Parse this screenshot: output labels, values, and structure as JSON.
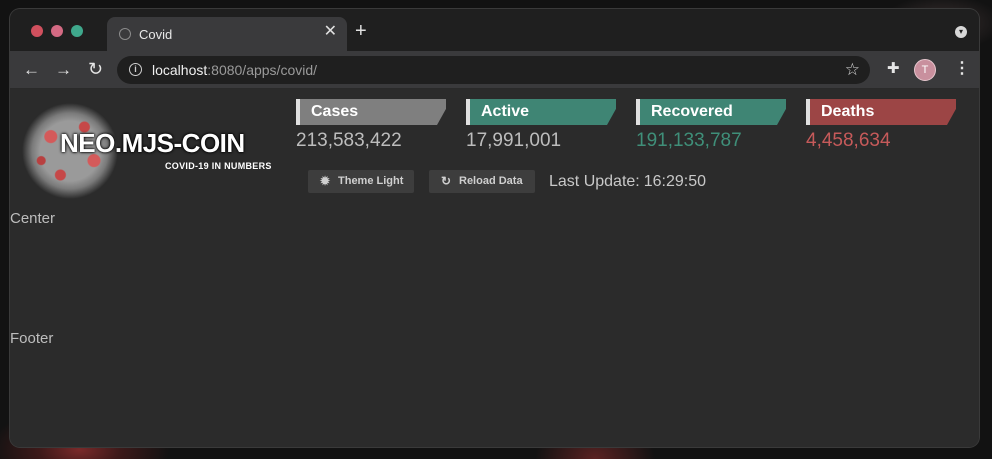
{
  "browser": {
    "tab": {
      "title": "Covid",
      "favicon": "globe-icon",
      "close_glyph": "✕"
    },
    "new_tab_glyph": "+",
    "address": {
      "host": "localhost",
      "rest": ":8080/apps/covid/"
    },
    "avatar_initial": "T"
  },
  "logo": {
    "title": "NEO.MJS-COIN",
    "subtitle": "COVID-19 IN NUMBERS"
  },
  "stats": {
    "cases": {
      "label": "Cases",
      "value": "213,583,422"
    },
    "active": {
      "label": "Active",
      "value": "17,991,001"
    },
    "recovered": {
      "label": "Recovered",
      "value": "191,133,787"
    },
    "deaths": {
      "label": "Deaths",
      "value": "4,458,634"
    }
  },
  "buttons": {
    "theme": {
      "label": "Theme Light",
      "icon": "sun-icon"
    },
    "reload": {
      "label": "Reload Data",
      "icon": "reload-icon"
    }
  },
  "last_update": {
    "label": "Last Update:",
    "time": "16:29:50"
  },
  "layout_labels": {
    "center": "Center",
    "footer": "Footer"
  },
  "colors": {
    "cases": "#7f7f7f",
    "active": "#3f8574",
    "recovered": "#3f8574",
    "deaths": "#9c4545"
  }
}
